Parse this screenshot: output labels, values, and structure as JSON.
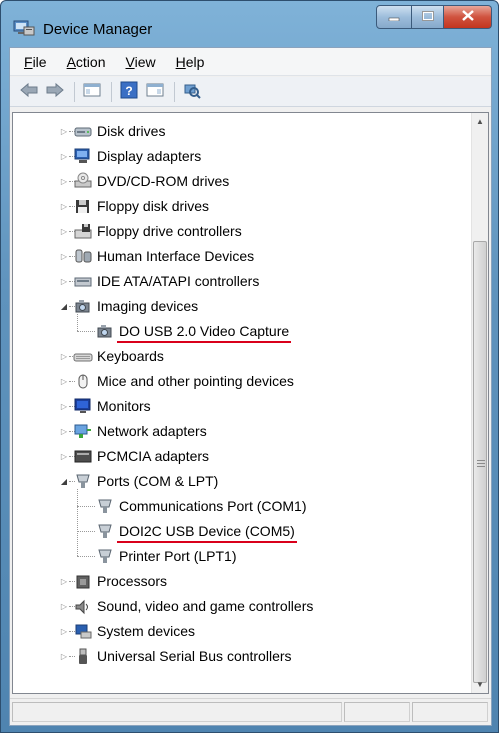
{
  "window": {
    "title": "Device Manager",
    "icon": "device-manager-icon"
  },
  "menu": [
    {
      "label": "File",
      "accelerator": "F",
      "rest": "ile"
    },
    {
      "label": "Action",
      "accelerator": "A",
      "rest": "ction"
    },
    {
      "label": "View",
      "accelerator": "V",
      "rest": "iew"
    },
    {
      "label": "Help",
      "accelerator": "H",
      "rest": "elp"
    }
  ],
  "toolbar": [
    {
      "name": "back-icon"
    },
    {
      "name": "forward-icon"
    },
    {
      "name": "show-hide-console-tree-icon"
    },
    {
      "name": "help-icon"
    },
    {
      "name": "show-hide-action-pane-icon"
    },
    {
      "name": "scan-hardware-icon"
    }
  ],
  "tree": [
    {
      "label": "Disk drives",
      "level": 0,
      "expanded": false,
      "icon": "disk-drive-icon"
    },
    {
      "label": "Display adapters",
      "level": 0,
      "expanded": false,
      "icon": "display-adapter-icon"
    },
    {
      "label": "DVD/CD-ROM drives",
      "level": 0,
      "expanded": false,
      "icon": "dvd-drive-icon"
    },
    {
      "label": "Floppy disk drives",
      "level": 0,
      "expanded": false,
      "icon": "floppy-drive-icon"
    },
    {
      "label": "Floppy drive controllers",
      "level": 0,
      "expanded": false,
      "icon": "floppy-controller-icon"
    },
    {
      "label": "Human Interface Devices",
      "level": 0,
      "expanded": false,
      "icon": "hid-icon"
    },
    {
      "label": "IDE ATA/ATAPI controllers",
      "level": 0,
      "expanded": false,
      "icon": "ide-controller-icon"
    },
    {
      "label": "Imaging devices",
      "level": 0,
      "expanded": true,
      "icon": "camera-icon"
    },
    {
      "label": "DO USB 2.0 Video Capture",
      "level": 1,
      "icon": "camera-icon",
      "highlight": true
    },
    {
      "label": "Keyboards",
      "level": 0,
      "expanded": false,
      "icon": "keyboard-icon"
    },
    {
      "label": "Mice and other pointing devices",
      "level": 0,
      "expanded": false,
      "icon": "mouse-icon"
    },
    {
      "label": "Monitors",
      "level": 0,
      "expanded": false,
      "icon": "monitor-icon"
    },
    {
      "label": "Network adapters",
      "level": 0,
      "expanded": false,
      "icon": "network-adapter-icon"
    },
    {
      "label": "PCMCIA adapters",
      "level": 0,
      "expanded": false,
      "icon": "pcmcia-icon"
    },
    {
      "label": "Ports (COM & LPT)",
      "level": 0,
      "expanded": true,
      "icon": "port-icon"
    },
    {
      "label": "Communications Port (COM1)",
      "level": 1,
      "icon": "port-icon"
    },
    {
      "label": "DOI2C USB Device (COM5)",
      "level": 1,
      "icon": "port-icon",
      "highlight": true
    },
    {
      "label": "Printer Port (LPT1)",
      "level": 1,
      "icon": "port-icon"
    },
    {
      "label": "Processors",
      "level": 0,
      "expanded": false,
      "icon": "processor-icon"
    },
    {
      "label": "Sound, video and game controllers",
      "level": 0,
      "expanded": false,
      "icon": "sound-icon"
    },
    {
      "label": "System devices",
      "level": 0,
      "expanded": false,
      "icon": "system-devices-icon"
    },
    {
      "label": "Universal Serial Bus controllers",
      "level": 0,
      "expanded": false,
      "icon": "usb-icon"
    }
  ],
  "colors": {
    "highlight_underline": "#d9001b",
    "titlebar": "#5f93bd"
  }
}
